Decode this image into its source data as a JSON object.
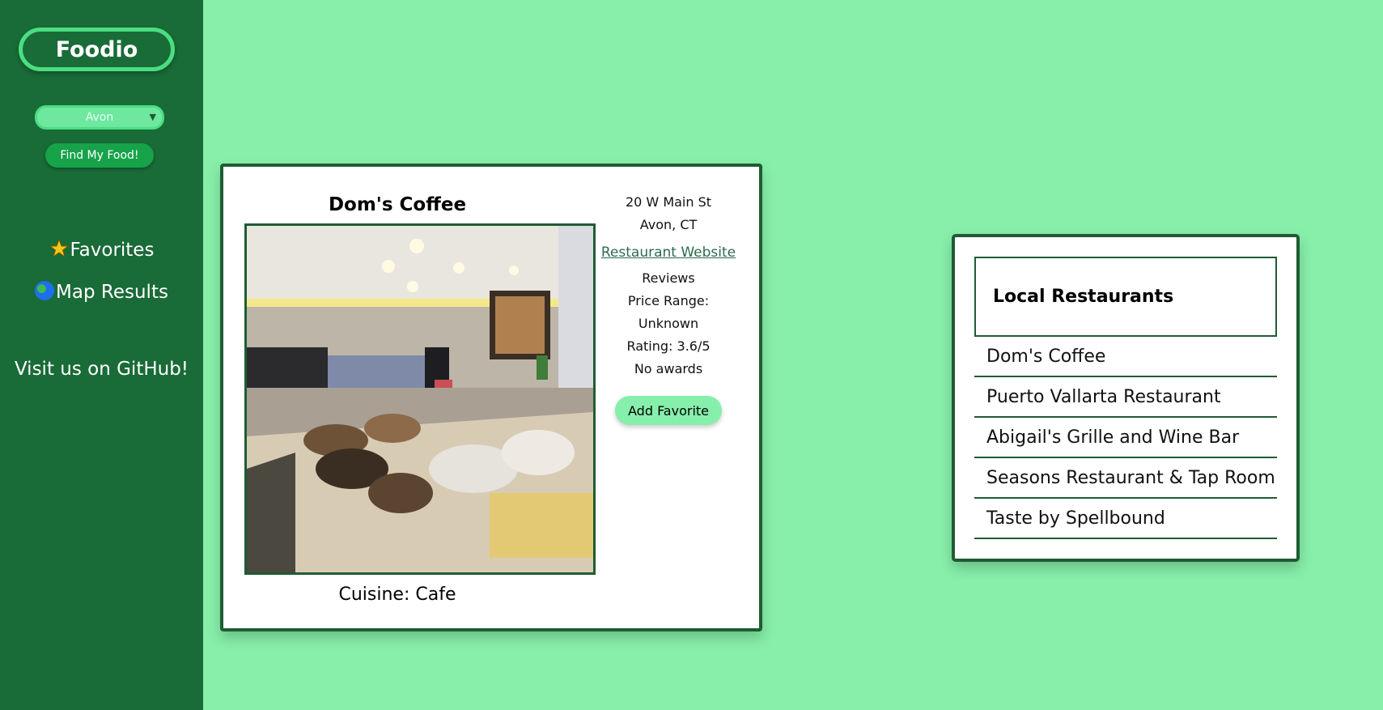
{
  "sidebar": {
    "logo": "Foodio",
    "city_select": {
      "value": "Avon"
    },
    "find_button": "Find My Food!",
    "nav": [
      {
        "label": "Favorites",
        "icon": "star-icon"
      },
      {
        "label": "Map Results",
        "icon": "globe-icon"
      }
    ],
    "github_link": "Visit us on GitHub!"
  },
  "restaurant": {
    "name": "Dom's Coffee",
    "cuisine": "Cuisine: Cafe",
    "address_line1": "20 W Main St",
    "address_line2": "Avon, CT",
    "website_link": "Restaurant Website",
    "reviews": "Reviews",
    "price_range_label": "Price Range:",
    "price_range_value": "Unknown",
    "rating": "Rating: 3.6/5",
    "awards": "No awards",
    "add_favorite_button": "Add Favorite"
  },
  "local_list": {
    "title": "Local Restaurants",
    "items": [
      "Dom's Coffee",
      "Puerto Vallarta Restaurant",
      "Abigail's Grille and Wine Bar",
      "Seasons Restaurant & Tap Room",
      "Taste by Spellbound"
    ]
  },
  "colors": {
    "background": "#87efaa",
    "sidebar": "#196b37",
    "accent": "#4ade80",
    "border": "#1f5c33"
  }
}
